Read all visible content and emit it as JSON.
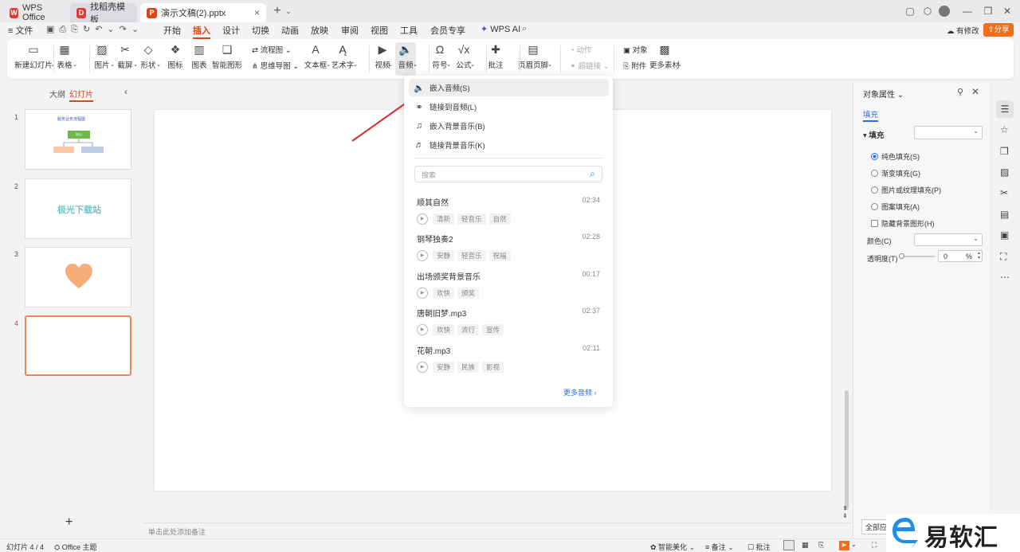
{
  "titlebar": {
    "tabs": [
      {
        "label": "WPS Office",
        "color": "#e53935",
        "logo": "W"
      },
      {
        "label": "找稻壳模板",
        "color": "#e53935",
        "logo": "D"
      },
      {
        "label": "演示文稿(2).pptx",
        "color": "#d9480f",
        "logo": "P"
      }
    ],
    "new_tab": "+"
  },
  "menubar": {
    "file": "文件",
    "items": [
      "开始",
      "插入",
      "设计",
      "切换",
      "动画",
      "放映",
      "审阅",
      "视图",
      "工具",
      "会员专享"
    ],
    "active": "插入",
    "wps_ai": "WPS AI",
    "edit_label": "有修改",
    "share_label": "分享"
  },
  "ribbon": {
    "buttons": [
      {
        "label": "新建幻灯片",
        "icon": "▭"
      },
      {
        "label": "表格",
        "icon": "▦"
      },
      {
        "label": "图片",
        "icon": "▨"
      },
      {
        "label": "截屏",
        "icon": "✂"
      },
      {
        "label": "形状",
        "icon": "◇"
      },
      {
        "label": "图标",
        "icon": "❖"
      },
      {
        "label": "图表",
        "icon": "▥"
      },
      {
        "label": "智能图形",
        "icon": "❏"
      },
      {
        "label": "流程图",
        "icon": "⇄"
      },
      {
        "label": "思维导图",
        "icon": "⋔"
      },
      {
        "label": "文本框",
        "icon": "A"
      },
      {
        "label": "艺术字",
        "icon": "Ą"
      },
      {
        "label": "视频",
        "icon": "▶"
      },
      {
        "label": "音频",
        "icon": "🔈"
      },
      {
        "label": "符号",
        "icon": "Ω"
      },
      {
        "label": "公式",
        "icon": "√x"
      },
      {
        "label": "批注",
        "icon": "✚"
      },
      {
        "label": "页眉页脚",
        "icon": "▤"
      },
      {
        "label": "动作",
        "icon": "◔"
      },
      {
        "label": "超链接",
        "icon": "⚭"
      },
      {
        "label": "对象",
        "icon": "▣"
      },
      {
        "label": "附件",
        "icon": "⎘"
      },
      {
        "label": "更多素材",
        "icon": "▩"
      }
    ]
  },
  "left_panel": {
    "tabs": [
      "大纲",
      "幻灯片"
    ],
    "active_tab": "幻灯片",
    "slides": [
      {
        "num": "1",
        "title": "服务业务流程图",
        "box_top": "核心",
        "box_left": "",
        "box_right": ""
      },
      {
        "num": "2",
        "text": "极光下载站"
      },
      {
        "num": "3"
      },
      {
        "num": "4"
      }
    ],
    "add": "+"
  },
  "dropdown": {
    "options": [
      {
        "label": "嵌入音频(S)",
        "icon": "🔈"
      },
      {
        "label": "链接到音频(L)",
        "icon": "⚭"
      },
      {
        "label": "嵌入背景音乐(B)",
        "icon": "♫"
      },
      {
        "label": "链接背景音乐(K)",
        "icon": "♬"
      }
    ],
    "search_placeholder": "搜索",
    "songs": [
      {
        "name": "顺其自然",
        "duration": "02:34",
        "tags": [
          "清新",
          "轻音乐",
          "自然"
        ]
      },
      {
        "name": "钢琴独奏2",
        "duration": "02:28",
        "tags": [
          "安静",
          "轻音乐",
          "祝福"
        ]
      },
      {
        "name": "出场颁奖背景音乐",
        "duration": "00:17",
        "tags": [
          "欢快",
          "颁奖"
        ]
      },
      {
        "name": "唐朝旧梦.mp3",
        "duration": "02:37",
        "tags": [
          "欢快",
          "流行",
          "宣传"
        ]
      },
      {
        "name": "花朝.mp3",
        "duration": "02:11",
        "tags": [
          "安静",
          "民族",
          "影视"
        ]
      }
    ],
    "more": "更多音频"
  },
  "right_panel": {
    "title": "对象属性",
    "tab": "填充",
    "section": "填充",
    "options": [
      "纯色填充(S)",
      "渐变填充(G)",
      "图片或纹理填充(P)",
      "图案填充(A)"
    ],
    "checkbox": "隐藏背景图形(H)",
    "color_label": "颜色(C)",
    "transparency_label": "透明度(T)",
    "transparency_value": "0",
    "transparency_unit": "%",
    "apply_all": "全部应用"
  },
  "notes_placeholder": "单击此处添加备注",
  "statusbar": {
    "slide_info": "幻灯片 4 / 4",
    "theme": "Office 主题",
    "beautify": "智能美化",
    "notes": "备注",
    "comments": "批注"
  },
  "watermark": {
    "text": "易软汇"
  },
  "colors": {
    "accent": "#d9480f",
    "share": "#f56c1a",
    "link": "#2b6de8",
    "arrow": "#d22f2f",
    "heart": "#f5ad7a"
  }
}
